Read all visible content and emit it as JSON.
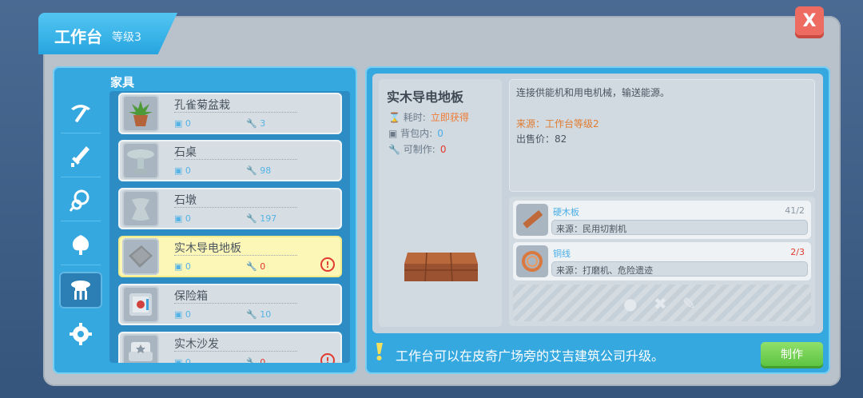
{
  "window": {
    "title": "工作台",
    "level": "等级3",
    "close_label": "X"
  },
  "category": {
    "label": "家具",
    "sidebar_icons": [
      "pickaxe-icon",
      "sword-icon",
      "chain-icon",
      "potion-icon",
      "table-icon",
      "gear-icon"
    ],
    "active_index": 4
  },
  "items": [
    {
      "name": "孔雀菊盆栽",
      "bag": "0",
      "craftable": "3",
      "selected": false,
      "warn": false,
      "thumb": "potted-plant-icon"
    },
    {
      "name": "石桌",
      "bag": "0",
      "craftable": "98",
      "selected": false,
      "warn": false,
      "thumb": "stone-table-icon"
    },
    {
      "name": "石墩",
      "bag": "0",
      "craftable": "197",
      "selected": false,
      "warn": false,
      "thumb": "stone-stool-icon"
    },
    {
      "name": "实木导电地板",
      "bag": "0",
      "craftable": "0",
      "selected": true,
      "warn": true,
      "warn_mark": "!",
      "thumb": "wood-floor-icon"
    },
    {
      "name": "保险箱",
      "bag": "0",
      "craftable": "10",
      "selected": false,
      "warn": false,
      "thumb": "safe-icon"
    },
    {
      "name": "实木沙发",
      "bag": "0",
      "craftable": "0",
      "selected": false,
      "warn": true,
      "warn_mark": "!",
      "thumb": "sofa-icon"
    }
  ],
  "detail": {
    "name": "实木导电地板",
    "time_label": "耗时:",
    "time_value": "立即获得",
    "bag_label": "背包内:",
    "bag_value": "0",
    "craft_label": "可制作:",
    "craft_value": "0",
    "description": "连接供能机和用电机械，输送能源。",
    "source": "来源：工作台等级2",
    "price": "出售价：82"
  },
  "materials": [
    {
      "name": "硬木板",
      "count": "41/2",
      "source": "来源：民用切割机",
      "insufficient": false,
      "thumb": "hardwood-plank-icon"
    },
    {
      "name": "铜线",
      "count": "2/3",
      "source": "来源：打磨机、危险遗迹",
      "insufficient": true,
      "thumb": "copper-wire-icon"
    }
  ],
  "tip": "工作台可以在皮奇广场旁的艾吉建筑公司升级。",
  "craft_button": "制作",
  "colors": {
    "accent_blue": "#36a8e0",
    "warn_red": "#e23a2e",
    "source_orange": "#e07c2f",
    "craft_green": "#5fc442",
    "close_red": "#ee6b61"
  }
}
